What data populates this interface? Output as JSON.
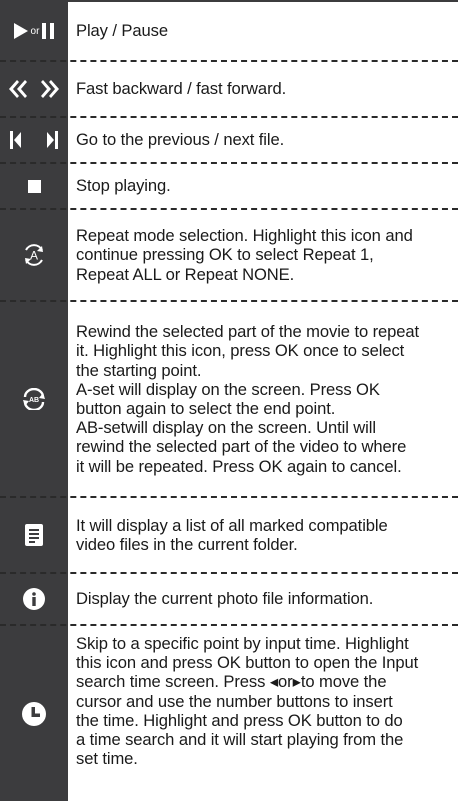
{
  "rows": [
    {
      "icon": "play-or-pause-icon",
      "or_label": "or",
      "text": "Play / Pause"
    },
    {
      "icon": "fast-backward-forward-icon",
      "text": "Fast backward / fast forward."
    },
    {
      "icon": "previous-next-file-icon",
      "text": "Go to the previous / next file."
    },
    {
      "icon": "stop-icon",
      "text": "Stop playing."
    },
    {
      "icon": "repeat-a-icon",
      "text": "Repeat mode selection. Highlight this icon and\ncontinue pressing OK to select Repeat 1,\nRepeat ALL or Repeat NONE."
    },
    {
      "icon": "repeat-ab-icon",
      "text": "Rewind the selected part of the movie to repeat\nit. Highlight this icon, press OK once to select\nthe  starting point.\nA-set will display on the screen. Press OK\nbutton again to select the end point.\nAB-setwill display on the screen. Until will\nrewind the selected part of the video to where\nit will be repeated. Press OK again to cancel."
    },
    {
      "icon": "file-list-icon",
      "text": "It will display a list of all marked compatible\nvideo files in the current folder."
    },
    {
      "icon": "info-icon",
      "text": "Display the current photo file information."
    },
    {
      "icon": "clock-icon",
      "text": "Skip to a specific point by input time. Highlight\nthis icon and press OK button to open the Input\nsearch time screen. Press ◂or▸to move the\ncursor and use the number buttons to insert\nthe time.  Highlight and press OK button to do\na time search and it will start playing from the\nset time."
    }
  ],
  "colors": {
    "icon_column": "#3c3c3e",
    "icon_glyph": "#ffffff",
    "text": "#1a1a1a"
  }
}
